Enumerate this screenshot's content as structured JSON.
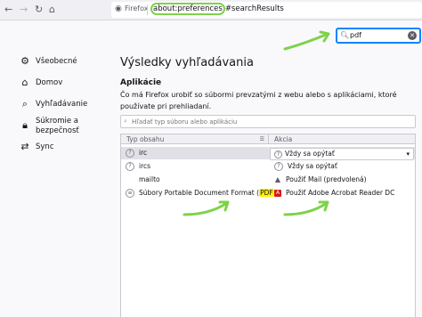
{
  "browser": {
    "back_icon": "arrow-left-icon",
    "forward_icon": "arrow-right-icon",
    "reload_icon": "reload-icon",
    "home_icon": "home-icon",
    "brand": "Firefox",
    "url_host": "about:preferences",
    "url_rest": "#searchResults"
  },
  "search": {
    "value": "pdf"
  },
  "sidebar": {
    "items": [
      {
        "label": "Všeobecné",
        "icon": "gear-icon"
      },
      {
        "label": "Domov",
        "icon": "home-icon"
      },
      {
        "label": "Vyhľadávanie",
        "icon": "search-icon"
      },
      {
        "label": "Súkromie a bezpečnosť",
        "line1": "Súkromie a",
        "line2": "bezpečnosť",
        "icon": "lock-icon"
      },
      {
        "label": "Sync",
        "icon": "sync-icon"
      }
    ]
  },
  "main": {
    "title": "Výsledky vyhľadávania",
    "section_title": "Aplikácie",
    "description": "Čo má Firefox urobiť so súbormi prevzatými z webu alebo s aplikáciami, ktoré používate pri prehliadaní.",
    "filter_placeholder": "Hľadať typ súboru alebo aplikáciu",
    "columns": {
      "type": "Typ obsahu",
      "action": "Akcia"
    },
    "rows": [
      {
        "type": "irc",
        "action": "Vždy sa opýtať",
        "selected": true
      },
      {
        "type": "ircs",
        "action": "Vždy sa opýtať"
      },
      {
        "type": "mailto",
        "action": "Použiť Mail (predvolená)"
      },
      {
        "type_prefix": "Súbory Portable Document Format (",
        "type_hl": "PDF",
        "type_suffix": ")",
        "action": "Použiť Adobe Acrobat Reader DC"
      }
    ]
  },
  "colors": {
    "accent": "#0a84ff",
    "annotation": "#7ed348",
    "highlight": "#fff200"
  }
}
